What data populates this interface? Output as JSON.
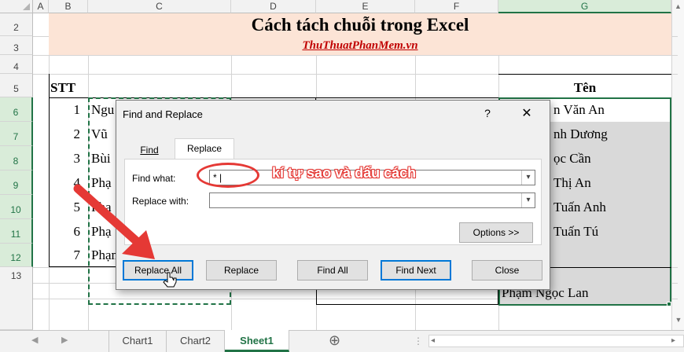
{
  "columns": [
    "A",
    "B",
    "C",
    "D",
    "E",
    "F",
    "G"
  ],
  "rows": [
    "2",
    "3",
    "4",
    "5",
    "6",
    "7",
    "8",
    "9",
    "10",
    "11",
    "12",
    "13"
  ],
  "sheet": {
    "title": "Cách tách chuỗi trong Excel",
    "link": "ThuThuatPhanMem.vn",
    "header_stt": "STT",
    "header_ten": "Tên",
    "stt": [
      "1",
      "2",
      "3",
      "4",
      "5",
      "6",
      "7"
    ],
    "name_prefixes": [
      "Ngu",
      "Vũ",
      "Bùi",
      "Phạ",
      "Phạ",
      "Phạ",
      "Phạm Ngọc Lan"
    ],
    "ten_values": [
      "n Văn An",
      "nh Dương",
      "ọc Cần",
      "Thị An",
      "Tuấn Anh",
      "Tuấn Tú",
      "Phạm Ngọc Lan"
    ]
  },
  "dialog": {
    "title": "Find and Replace",
    "help": "?",
    "close": "✕",
    "tabs": [
      "Find",
      "Replace"
    ],
    "active_tab": "Replace",
    "find_label": "Find what:",
    "find_value": "* |",
    "replace_label": "Replace with:",
    "replace_value": "",
    "options_button": "Options >>",
    "buttons": {
      "replace_all": "Replace All",
      "replace": "Replace",
      "find_all": "Find All",
      "find_next": "Find Next",
      "close": "Close"
    }
  },
  "annotation": {
    "text": "kí tự sao và dấu cách",
    "color": "#e53935"
  },
  "tabs_bar": {
    "sheets": [
      "Chart1",
      "Chart2",
      "Sheet1"
    ],
    "active": "Sheet1",
    "add": "⊕"
  },
  "colors": {
    "accent": "#217346",
    "red": "#e53935",
    "focus": "#0078d7",
    "link": "#c00000",
    "title_fill": "#fce4d6"
  }
}
